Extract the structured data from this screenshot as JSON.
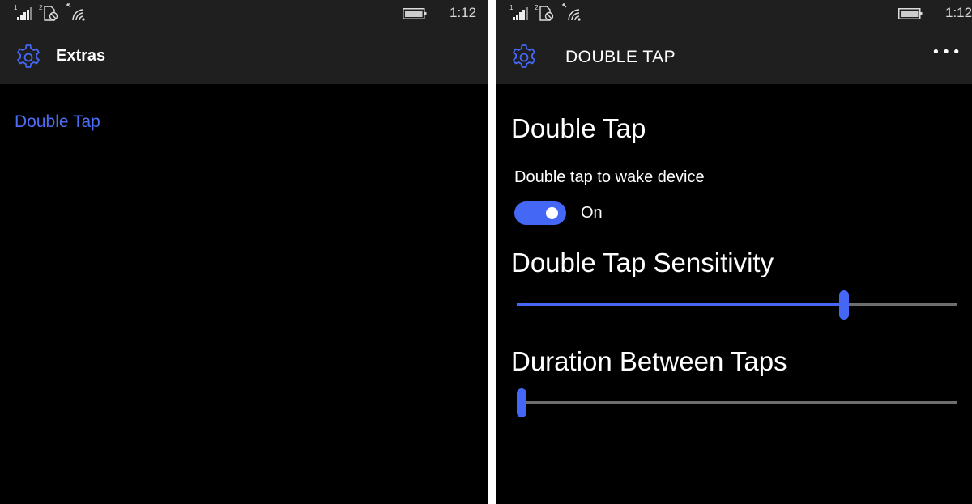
{
  "status_bar": {
    "sim1_label": "1",
    "sim2_label": "2",
    "time": "1:12",
    "icons": [
      "signal-bars-icon",
      "sim2-no-service-icon",
      "wifi-icon",
      "battery-icon"
    ]
  },
  "left_screen": {
    "header": {
      "title": "Extras",
      "icon": "gear-icon"
    },
    "items": [
      {
        "label": "Double Tap"
      }
    ]
  },
  "right_screen": {
    "header": {
      "title": "DOUBLE TAP",
      "icon": "gear-icon",
      "more_label": "•••"
    },
    "heading": "Double Tap",
    "toggle": {
      "label": "Double tap to wake device",
      "state_label": "On",
      "value": true
    },
    "sensitivity": {
      "heading": "Double Tap Sensitivity",
      "value_fraction": 0.744
    },
    "duration": {
      "heading": "Duration Between Taps",
      "value_fraction": 0.0
    }
  },
  "colors": {
    "accent": "#4467f5",
    "link": "#4d6ef6",
    "header_bg": "#1f1f1f",
    "background": "#000000",
    "track": "#6e6e6e"
  }
}
